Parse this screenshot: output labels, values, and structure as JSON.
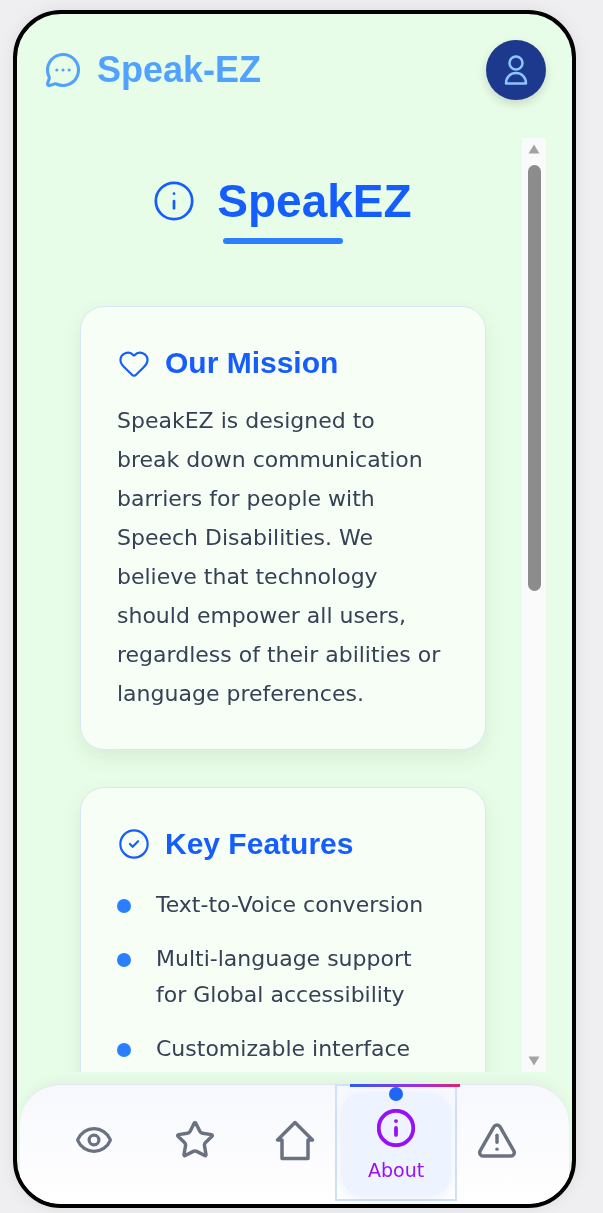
{
  "header": {
    "logo_text": "Speak-EZ"
  },
  "page": {
    "title": "SpeakEZ"
  },
  "sections": [
    {
      "kind": "paragraph",
      "title": "Our Mission",
      "text": "SpeakEZ is designed to break down communication barriers for people with Speech Disabilities. We believe that technology should empower all users, regardless of their abilities or language preferences."
    },
    {
      "kind": "list",
      "title": "Key Features",
      "items": [
        "Text-to-Voice conversion",
        "Multi-language support for Global accessibility",
        "Customizable interface"
      ]
    }
  ],
  "bottom_nav": {
    "items": [
      {
        "selected": false
      },
      {
        "selected": false
      },
      {
        "selected": false
      },
      {
        "label": "About",
        "selected": true
      },
      {
        "selected": false
      }
    ]
  }
}
